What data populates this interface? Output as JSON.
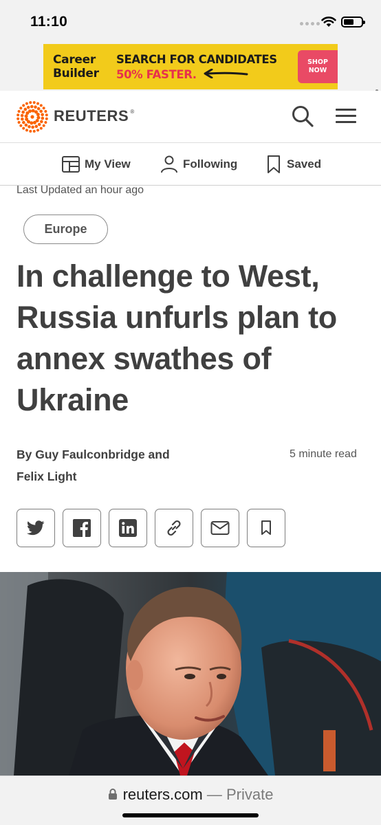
{
  "status_bar": {
    "time": "11:10",
    "icons": [
      "signal-dots-icon",
      "wifi-icon",
      "battery-icon"
    ]
  },
  "ad": {
    "brand_line1": "Career",
    "brand_line2": "Builder",
    "tagline_line1": "SEARCH FOR CANDIDATES",
    "tagline_line2": "50% FASTER.",
    "cta_line1": "SHOP",
    "cta_line2": "NOW",
    "background_color": "#f2cb1b",
    "accent_color": "#e7314c"
  },
  "header": {
    "logo_text": "REUTERS",
    "logo_mark": "®",
    "logo_color": "#fa6400",
    "icons": [
      "search-icon",
      "hamburger-menu-icon"
    ]
  },
  "subnav": {
    "items": [
      {
        "label": "My View",
        "icon": "layout-icon"
      },
      {
        "label": "Following",
        "icon": "person-icon"
      },
      {
        "label": "Saved",
        "icon": "bookmark-icon"
      }
    ]
  },
  "article": {
    "last_updated": "Last Updated an hour ago",
    "section": "Europe",
    "headline": "In challenge to West, Russia unfurls plan to annex swathes of Ukraine",
    "byline_line1": "By Guy Faulconbridge and",
    "byline_line2": "Felix Light",
    "read_time": "5 minute read",
    "share_icons": [
      "twitter-icon",
      "facebook-icon",
      "linkedin-icon",
      "link-icon",
      "email-icon",
      "bookmark-icon"
    ]
  },
  "browser": {
    "domain": "reuters.com",
    "mode": "— Private"
  }
}
